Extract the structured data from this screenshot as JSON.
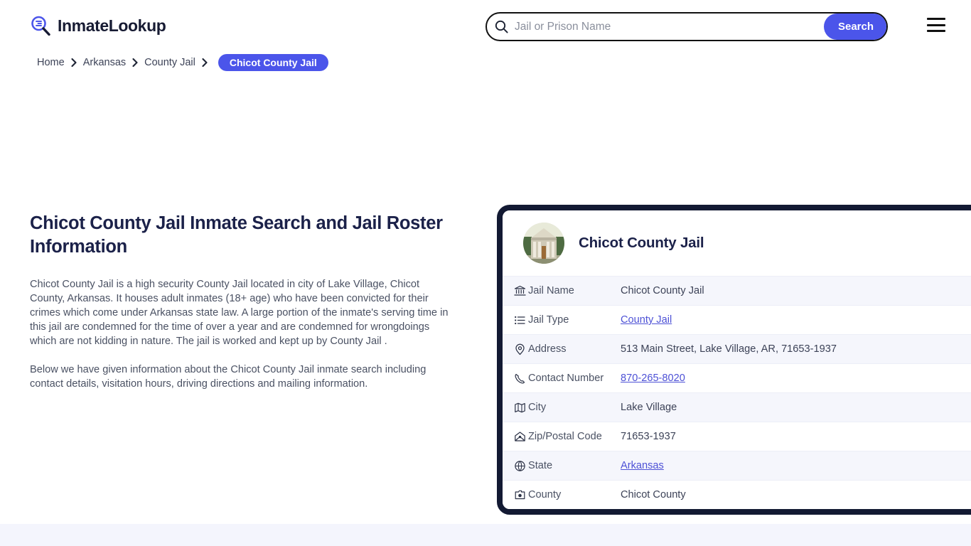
{
  "header": {
    "brand_name": "InmateLookup",
    "logo_icon": "magnifier-list-icon",
    "search": {
      "icon": "search-icon",
      "placeholder": "Jail or Prison Name",
      "value": "",
      "button_label": "Search"
    },
    "menu_icon": "hamburger-menu-icon",
    "accent_color": "#4b55ea"
  },
  "breadcrumb": {
    "items": [
      {
        "label": "Home",
        "current": false
      },
      {
        "label": "Arkansas",
        "current": false
      },
      {
        "label": "County Jail",
        "current": false
      },
      {
        "label": "Chicot County Jail",
        "current": true
      }
    ],
    "separator_icon": "chevron-right-icon"
  },
  "main": {
    "page_title": "Chicot County Jail Inmate Search and Jail Roster Information",
    "paragraphs": [
      "Chicot County Jail is a high security County Jail located in city of Lake Village, Chicot County, Arkansas. It houses adult inmates (18+ age) who have been convicted for their crimes which come under Arkansas state law. A large portion of the inmate's serving time in this jail are condemned for the time of over a year and are condemned for wrongdoings which are not kidding in nature. The jail is worked and kept up by County Jail .",
      "Below we have given information about the Chicot County Jail inmate search including contact details, visitation hours, driving directions and mailing information."
    ]
  },
  "card": {
    "title": "Chicot County Jail",
    "thumbnail_icon": "courthouse-photo",
    "border_color": "#131a33",
    "rows": [
      {
        "icon": "bank-icon",
        "label": "Jail Name",
        "value": "Chicot County Jail",
        "link": false
      },
      {
        "icon": "list-icon",
        "label": "Jail Type",
        "value": "County Jail",
        "link": true
      },
      {
        "icon": "map-pin-icon",
        "label": "Address",
        "value": "513 Main Street, Lake Village, AR, 71653-1937",
        "link": false
      },
      {
        "icon": "phone-icon",
        "label": "Contact Number",
        "value": "870-265-8020",
        "link": true
      },
      {
        "icon": "map-icon",
        "label": "City",
        "value": "Lake Village",
        "link": false
      },
      {
        "icon": "mail-icon",
        "label": "Zip/Postal Code",
        "value": "71653-1937",
        "link": false
      },
      {
        "icon": "globe-icon",
        "label": "State",
        "value": "Arkansas",
        "link": true
      },
      {
        "icon": "marker-icon",
        "label": "County",
        "value": "Chicot County",
        "link": false
      }
    ]
  },
  "footer": {
    "band_color": "#f4f5fd"
  }
}
